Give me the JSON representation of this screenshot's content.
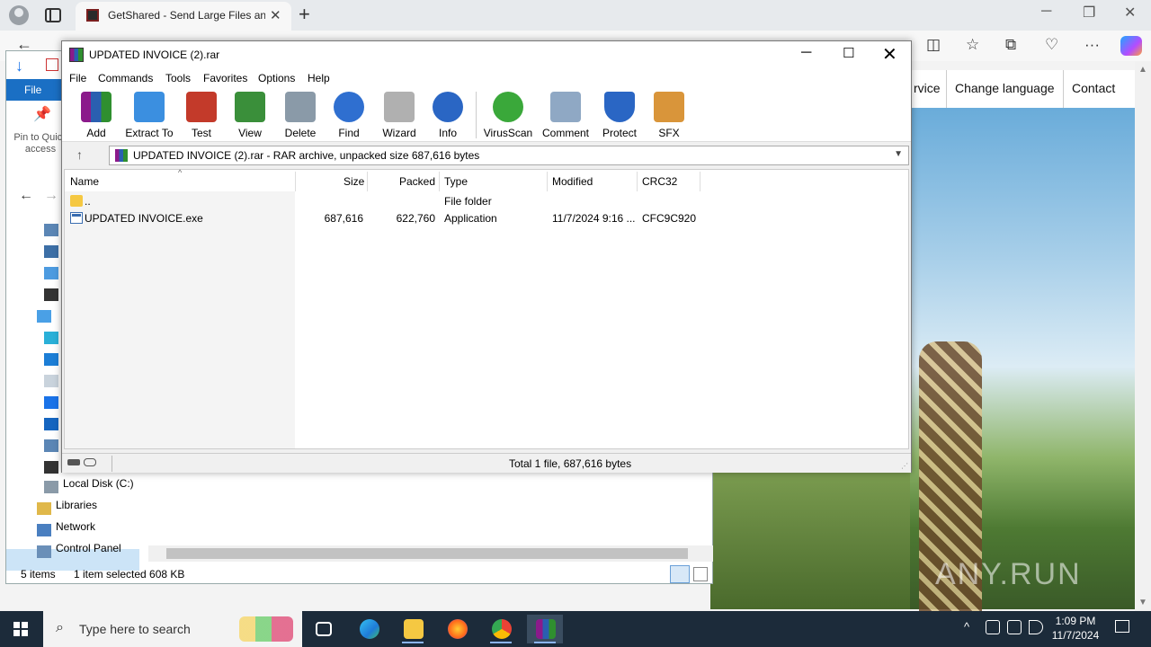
{
  "browser": {
    "tab_title": "GetShared - Send Large Files and",
    "tab_close": "✕",
    "new_tab": "+",
    "window_controls": {
      "minimize": "─",
      "maximize": "❐",
      "close": "✕"
    },
    "nav": {
      "back": "←",
      "split": "◫",
      "favorites": "☆",
      "collections": "⧉",
      "performance": "♡",
      "more": "···"
    }
  },
  "site": {
    "nav": {
      "service": "rvice",
      "language": "Change language",
      "contact": "Contact"
    },
    "watermark": "ANY.RUN"
  },
  "explorer": {
    "file_tab": "File",
    "pin_label": "Pin to Quick access",
    "tree": {
      "local_disk": "Local Disk (C:)",
      "libraries": "Libraries",
      "network": "Network",
      "control_panel": "Control Panel"
    },
    "status": {
      "items": "5 items",
      "selected": "1 item selected  608 KB"
    }
  },
  "winrar": {
    "title": "UPDATED INVOICE (2).rar",
    "window_controls": {
      "minimize": "─",
      "maximize": "☐",
      "close": "✕"
    },
    "menu": [
      "File",
      "Commands",
      "Tools",
      "Favorites",
      "Options",
      "Help"
    ],
    "toolbar": [
      {
        "label": "Add",
        "icon": "add-archive-icon",
        "color": "#8b1a8b"
      },
      {
        "label": "Extract To",
        "icon": "extract-folder-icon",
        "color": "#3b8fe0"
      },
      {
        "label": "Test",
        "icon": "test-clipboard-icon",
        "color": "#c33a2a"
      },
      {
        "label": "View",
        "icon": "view-book-icon",
        "color": "#3a8f3a"
      },
      {
        "label": "Delete",
        "icon": "delete-bin-icon",
        "color": "#8a9aa8"
      },
      {
        "label": "Find",
        "icon": "find-magnifier-icon",
        "color": "#2f6fd0"
      },
      {
        "label": "Wizard",
        "icon": "wizard-wand-icon",
        "color": "#b0b0b0"
      },
      {
        "label": "Info",
        "icon": "info-icon",
        "color": "#2a66c4"
      },
      {
        "label": "VirusScan",
        "icon": "virusscan-bug-icon",
        "color": "#3aa83a"
      },
      {
        "label": "Comment",
        "icon": "comment-icon",
        "color": "#8fa8c4"
      },
      {
        "label": "Protect",
        "icon": "protect-shield-icon",
        "color": "#2a66c4"
      },
      {
        "label": "SFX",
        "icon": "sfx-box-icon",
        "color": "#d9953a"
      }
    ],
    "address": "UPDATED INVOICE (2).rar - RAR archive, unpacked size 687,616 bytes",
    "columns": {
      "name": "Name",
      "size": "Size",
      "packed": "Packed",
      "type": "Type",
      "modified": "Modified",
      "crc": "CRC32"
    },
    "rows": [
      {
        "name": "..",
        "size": "",
        "packed": "",
        "type": "File folder",
        "modified": "",
        "crc": ""
      },
      {
        "name": "UPDATED INVOICE.exe",
        "size": "687,616",
        "packed": "622,760",
        "type": "Application",
        "modified": "11/7/2024 9:16 ...",
        "crc": "CFC9C920"
      }
    ],
    "status": "Total 1 file, 687,616 bytes"
  },
  "taskbar": {
    "search_placeholder": "Type here to search",
    "time": "1:09 PM",
    "date": "11/7/2024"
  }
}
